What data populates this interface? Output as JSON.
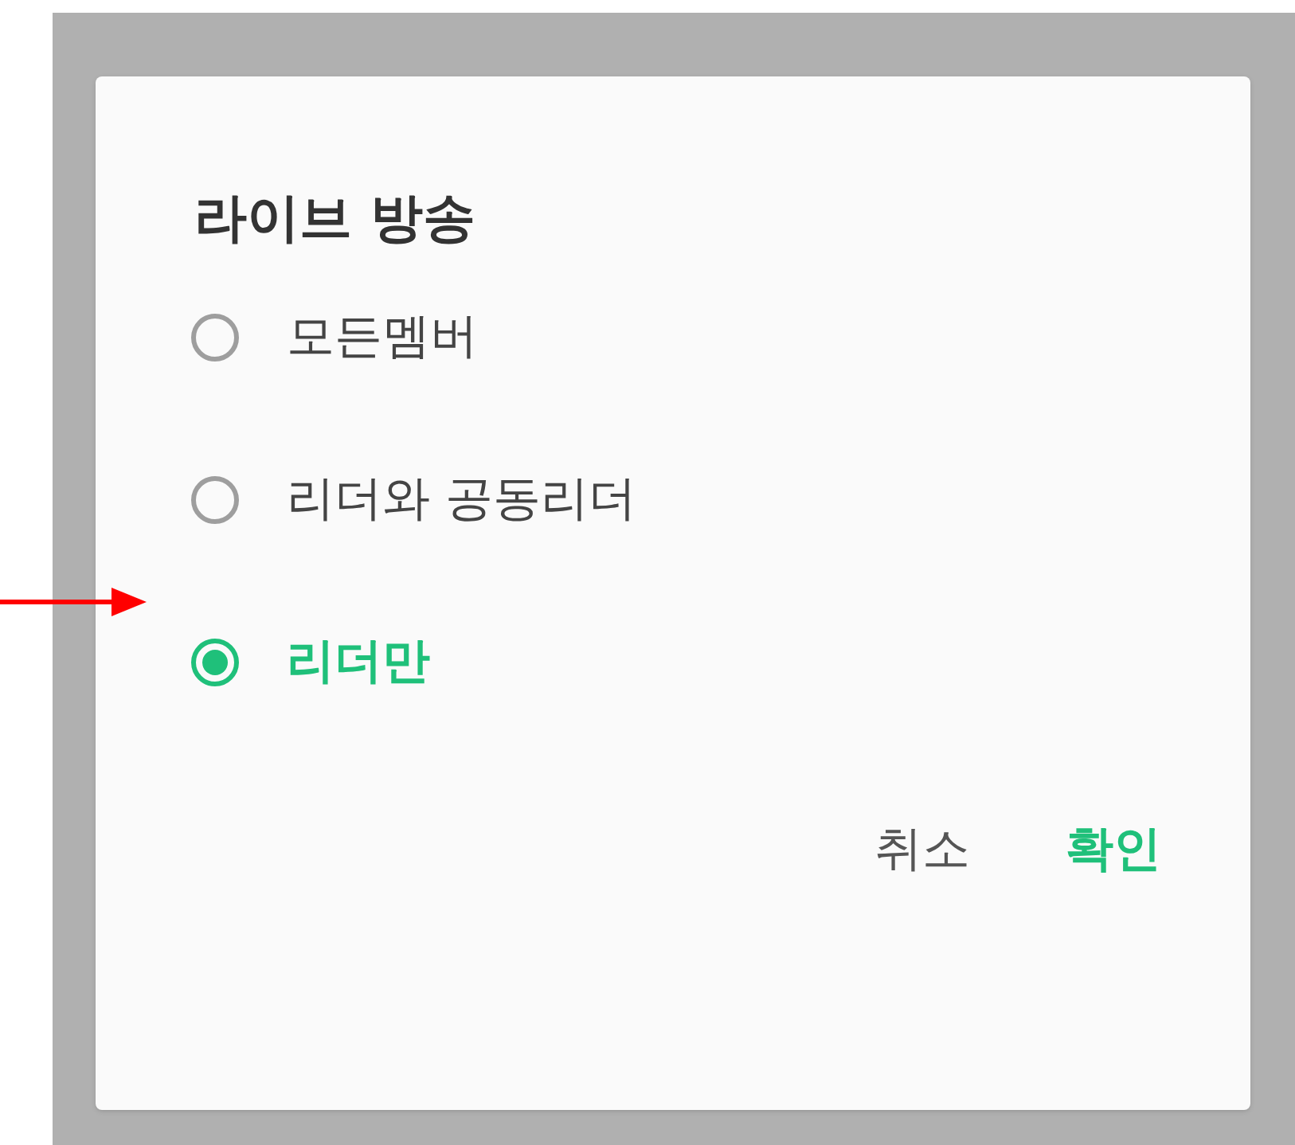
{
  "dialog": {
    "title": "라이브 방송",
    "options": [
      {
        "label": "모든멤버",
        "selected": false
      },
      {
        "label": "리더와 공동리더",
        "selected": false
      },
      {
        "label": "리더만",
        "selected": true
      }
    ],
    "buttons": [
      {
        "label": "취소",
        "kind": "secondary"
      },
      {
        "label": "확인",
        "kind": "primary"
      }
    ]
  }
}
